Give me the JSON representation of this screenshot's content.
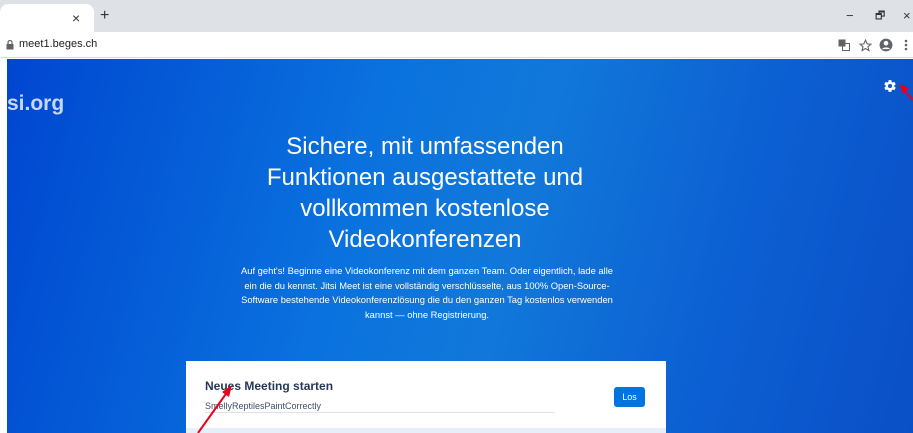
{
  "browser": {
    "tab_close": "×",
    "new_tab": "+",
    "window_min": "−",
    "window_restore": "🗗",
    "window_close": "×",
    "url": "meet1.beges.ch",
    "icons": [
      "lock-icon",
      "translate-icon",
      "star-icon",
      "account-icon",
      "menu-icon"
    ]
  },
  "page": {
    "logo_fragment": "si.org",
    "headline_lines": [
      "Sichere, mit umfassenden",
      "Funktionen ausgestattete und",
      "vollkommen kostenlose",
      "Videokonferenzen"
    ],
    "description_lines": [
      "Auf geht's! Beginne eine Videokonferenz mit dem ganzen Team. Oder eigentlich, lade alle",
      "ein die du kennst. Jitsi Meet ist eine vollständig verschlüsselte, aus 100% Open-Source-",
      "Software bestehende Videokonferenzlösung die du den ganzen Tag kostenlos verwenden",
      "kannst — ohne Registrierung."
    ],
    "card": {
      "title": "Neues Meeting starten",
      "room_value": "SmellyReptilesPaintCorrectly",
      "go_label": "Los"
    },
    "colors": {
      "background_accent": "#0a72de",
      "button": "#0074e0",
      "annotation_arrow": "#e8001c"
    }
  }
}
